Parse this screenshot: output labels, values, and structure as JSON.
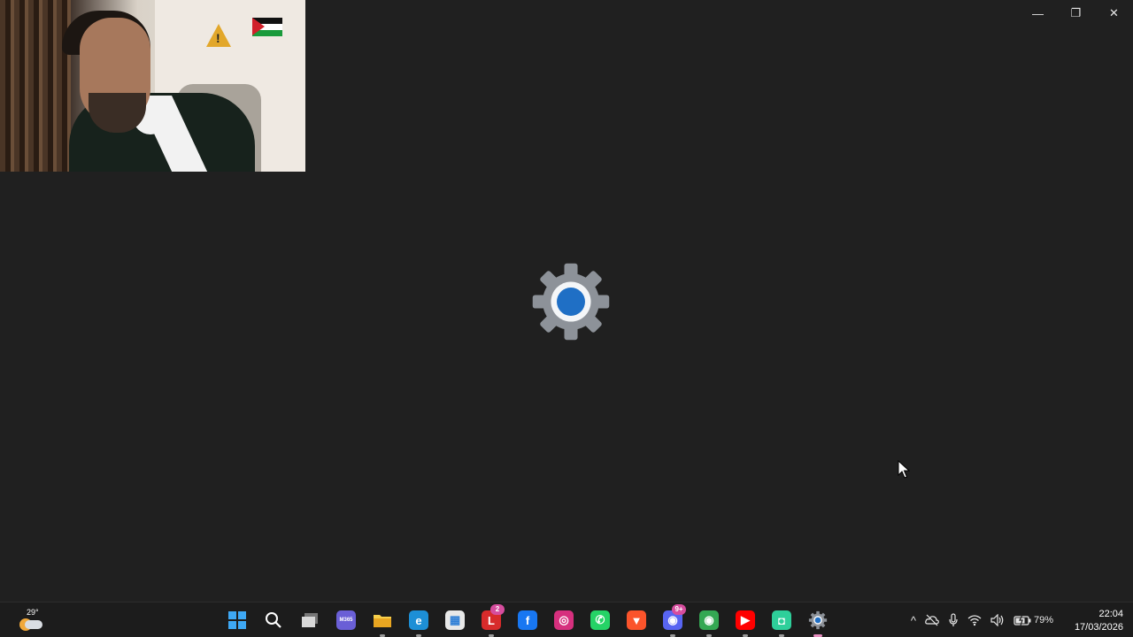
{
  "window": {
    "minimize_glyph": "—",
    "restore_glyph": "❐",
    "close_glyph": "✕"
  },
  "splash": {
    "icon": "settings-gear-icon",
    "accent": "#1f6fc5"
  },
  "taskbar": {
    "weather": {
      "temp": "29°",
      "icon": "partly-sunny-icon"
    },
    "apps": [
      {
        "name": "start",
        "icon": "windows-start-icon",
        "color": "#2f9bf0",
        "glyph": "",
        "badge": ""
      },
      {
        "name": "search",
        "icon": "search-icon",
        "color": "transparent",
        "glyph": "⌕",
        "badge": ""
      },
      {
        "name": "task-view",
        "icon": "task-view-icon",
        "color": "#555",
        "glyph": "",
        "badge": ""
      },
      {
        "name": "m365",
        "icon": "microsoft-365-icon",
        "color": "#6a5fd6",
        "glyph": "M365",
        "badge": ""
      },
      {
        "name": "file-explorer",
        "icon": "folder-icon",
        "color": "#f2bf3a",
        "glyph": "",
        "badge": ""
      },
      {
        "name": "edge",
        "icon": "edge-icon",
        "color": "#1d8fd6",
        "glyph": "e",
        "badge": ""
      },
      {
        "name": "store",
        "icon": "store-icon",
        "color": "#e8e8e8",
        "glyph": "▦",
        "badge": ""
      },
      {
        "name": "lapp",
        "icon": "l-app-icon",
        "color": "#d72b2b",
        "glyph": "L",
        "badge": "2"
      },
      {
        "name": "facebook",
        "icon": "facebook-icon",
        "color": "#1877f2",
        "glyph": "f",
        "badge": ""
      },
      {
        "name": "instagram",
        "icon": "instagram-icon",
        "color": "#d6307e",
        "glyph": "◎",
        "badge": ""
      },
      {
        "name": "whatsapp",
        "icon": "whatsapp-icon",
        "color": "#25d366",
        "glyph": "✆",
        "badge": ""
      },
      {
        "name": "brave",
        "icon": "brave-icon",
        "color": "#fb542b",
        "glyph": "▼",
        "badge": ""
      },
      {
        "name": "discord",
        "icon": "discord-icon",
        "color": "#5865f2",
        "glyph": "◉",
        "badge": "9+"
      },
      {
        "name": "chrome",
        "icon": "chrome-icon",
        "color": "#34a853",
        "glyph": "◉",
        "badge": ""
      },
      {
        "name": "youtube",
        "icon": "youtube-icon",
        "color": "#ff0000",
        "glyph": "▶",
        "badge": ""
      },
      {
        "name": "android-app",
        "icon": "android-icon",
        "color": "#2ecf9a",
        "glyph": "◘",
        "badge": ""
      },
      {
        "name": "settings",
        "icon": "settings-gear-icon",
        "color": "#8a8f96",
        "glyph": "⚙",
        "badge": ""
      }
    ],
    "tray": {
      "chevron": "^",
      "battery": "79%"
    },
    "clock": {
      "time": "22:04",
      "date": "17/03/2026"
    }
  }
}
